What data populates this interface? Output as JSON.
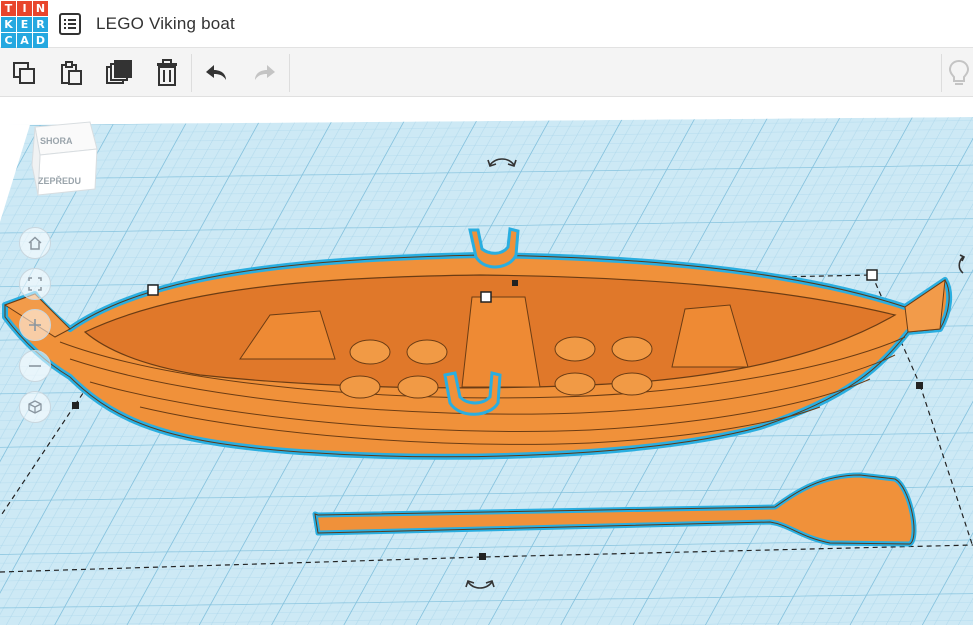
{
  "app": {
    "logo_letters": [
      "T",
      "I",
      "N",
      "K",
      "E",
      "R",
      "C",
      "A",
      "D"
    ],
    "logo_colors": [
      "#e8452c",
      "#e8452c",
      "#e8452c",
      "#25a8e0",
      "#25a8e0",
      "#25a8e0",
      "#25a8e0",
      "#25a8e0",
      "#25a8e0"
    ],
    "title": "LEGO Viking boat"
  },
  "toolbar": {
    "copy": "copy-icon",
    "paste": "paste-icon",
    "duplicate": "duplicate-icon",
    "delete": "trash-icon",
    "undo": "undo-icon",
    "redo": "redo-icon",
    "hint": "lightbulb-icon"
  },
  "viewcube": {
    "top_label": "SHORA",
    "front_label": "ZEPŘEDU"
  },
  "colors": {
    "grid_bg": "#cde9f5",
    "grid_line": "#9ccde4",
    "object_fill": "#f0913a",
    "object_outline": "#2aaee0",
    "accent_red": "#e8452c",
    "accent_blue": "#25a8e0"
  }
}
